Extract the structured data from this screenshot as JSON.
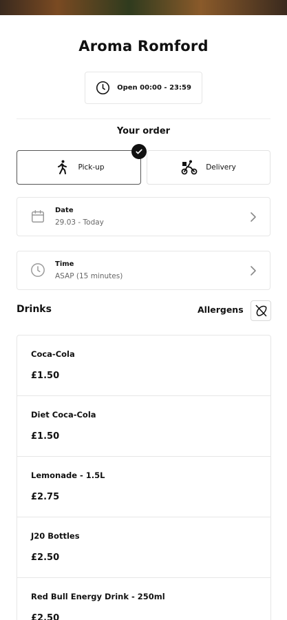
{
  "restaurant": {
    "name": "Aroma Romford",
    "hours": "Open 00:00 - 23:59"
  },
  "order": {
    "section_title": "Your order",
    "modes": [
      {
        "label": "Pick-up",
        "selected": true
      },
      {
        "label": "Delivery",
        "selected": false
      }
    ],
    "date": {
      "label": "Date",
      "value": "29.03 - Today"
    },
    "time": {
      "label": "Time",
      "value": "ASAP (15 minutes)"
    }
  },
  "menu": {
    "category": "Drinks",
    "allergens_label": "Allergens",
    "items": [
      {
        "name": "Coca-Cola",
        "price": "£1.50"
      },
      {
        "name": "Diet Coca-Cola",
        "price": "£1.50"
      },
      {
        "name": "Lemonade - 1.5L",
        "price": "£2.75"
      },
      {
        "name": "J20 Bottles",
        "price": "£2.50"
      },
      {
        "name": "Red Bull Energy Drink - 250ml",
        "price": "£2.50"
      }
    ]
  }
}
